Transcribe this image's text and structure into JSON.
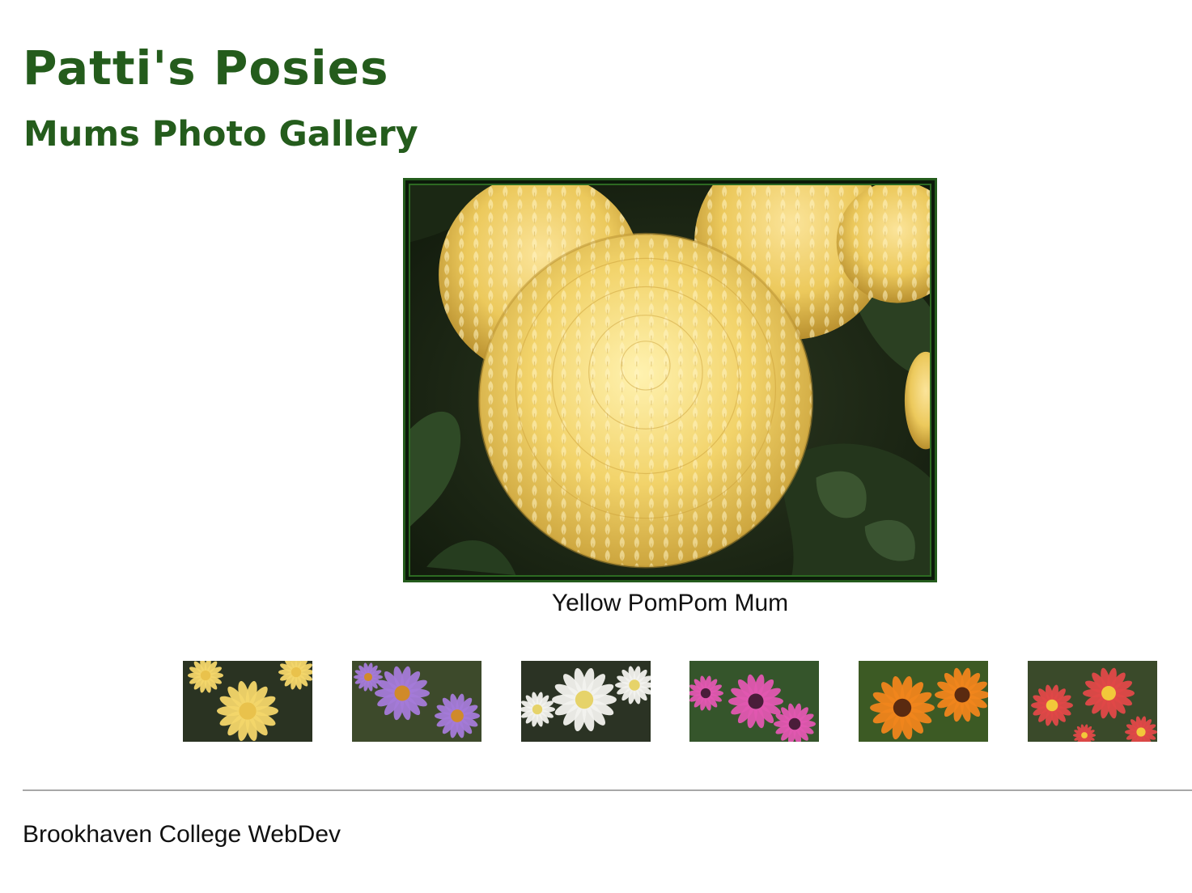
{
  "header": {
    "title": "Patti's Posies",
    "subtitle": "Mums Photo Gallery"
  },
  "gallery": {
    "main_image_icon": "yellow-pompom-mum-photo",
    "caption": "Yellow PomPom Mum",
    "thumbnails": [
      {
        "icon": "yellow-pompom-mum-thumbnail",
        "colors": {
          "bg": "#2a3322",
          "petal": "#f3d66a",
          "center": "#e9c24c"
        }
      },
      {
        "icon": "purple-aster-thumbnail",
        "colors": {
          "bg": "#3d4a2b",
          "petal": "#a47ad8",
          "center": "#d08a2a"
        }
      },
      {
        "icon": "white-mum-thumbnail",
        "colors": {
          "bg": "#2b3324",
          "petal": "#f2f2ee",
          "center": "#e6d36a"
        }
      },
      {
        "icon": "pink-daisy-thumbnail",
        "colors": {
          "bg": "#35552b",
          "petal": "#e257b0",
          "center": "#4a1d3a"
        }
      },
      {
        "icon": "orange-rudbeckia-thumbnail",
        "colors": {
          "bg": "#3c5a24",
          "petal": "#f0851c",
          "center": "#5a2a10"
        }
      },
      {
        "icon": "red-mum-thumbnail",
        "colors": {
          "bg": "#3a4a2a",
          "petal": "#e04848",
          "center": "#f2c83a"
        }
      }
    ]
  },
  "footer": {
    "text": "Brookhaven College WebDev"
  },
  "colors": {
    "heading": "#245c1c",
    "frame": "#245c1c",
    "rule": "#a8a8a8",
    "text": "#111111"
  }
}
